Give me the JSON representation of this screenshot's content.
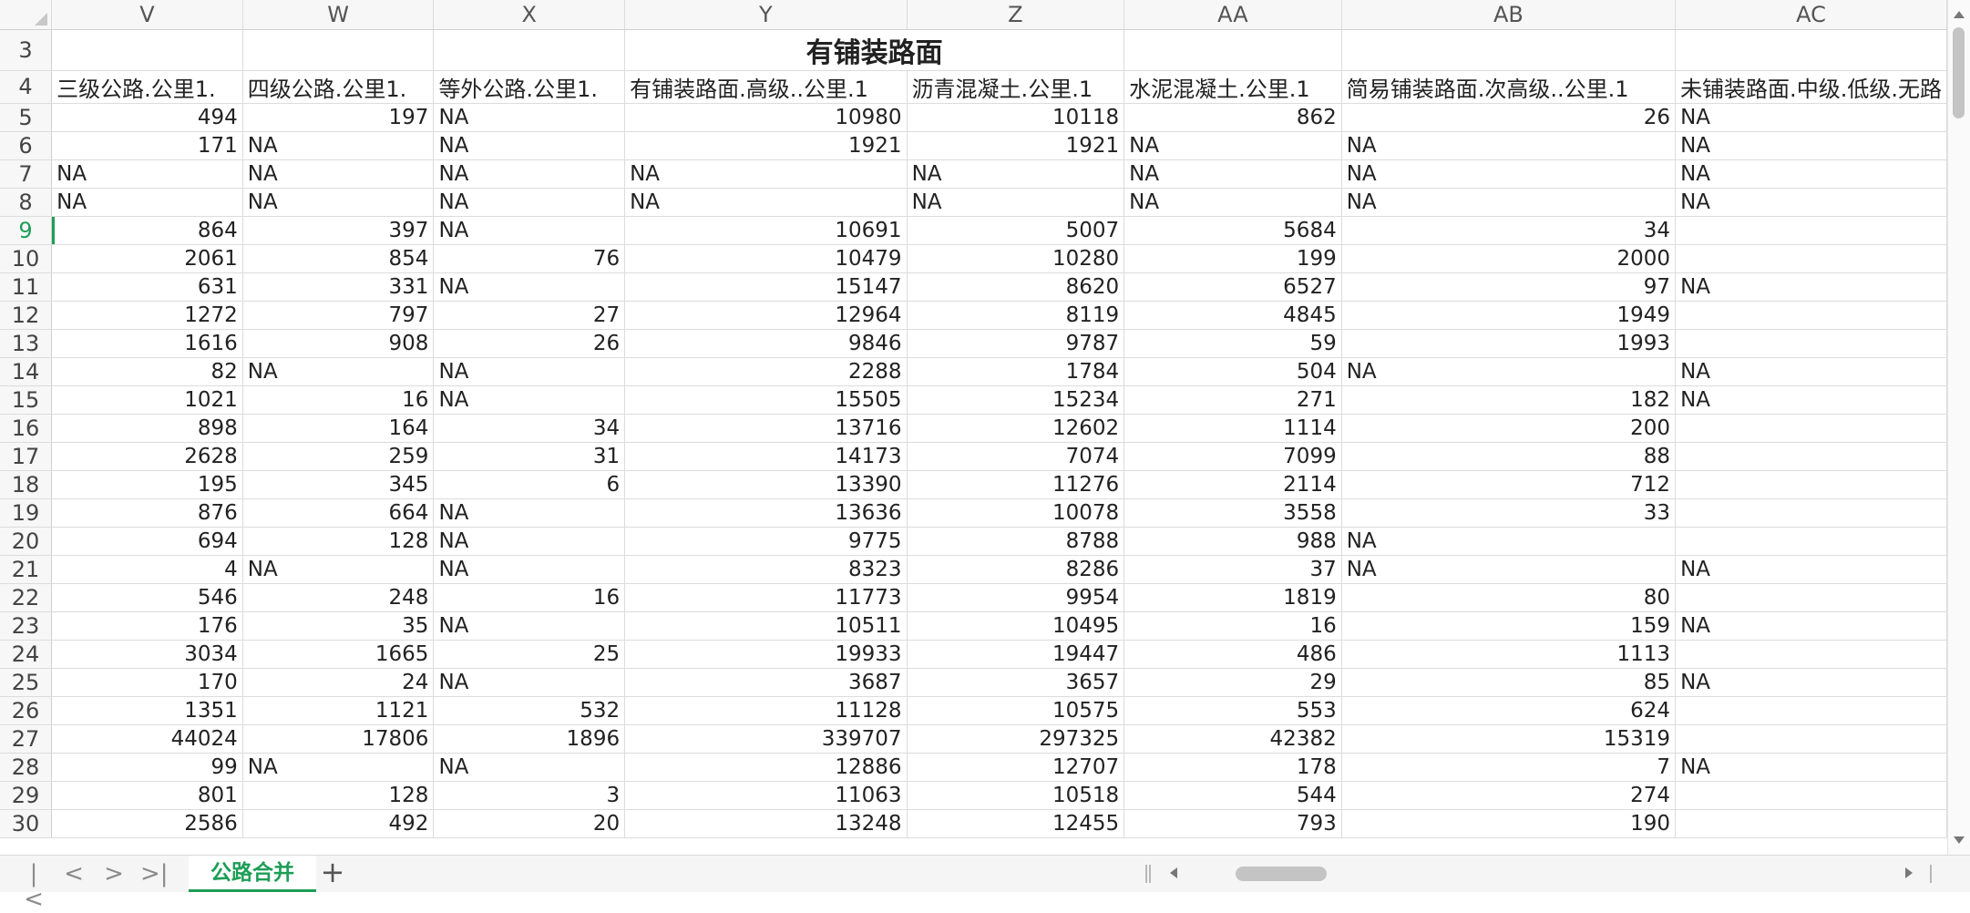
{
  "sheet": {
    "columns": [
      "V",
      "W",
      "X",
      "Y",
      "Z",
      "AA",
      "AB",
      "AC"
    ],
    "title_row": {
      "row": "3",
      "title": "有铺装路面"
    },
    "header_row": {
      "row": "4",
      "cells": [
        "三级公路.公里1.",
        "四级公路.公里1.",
        "等外公路.公里1.",
        "有铺装路面.高级..公里.1",
        "沥青混凝土.公里.1",
        "水泥混凝土.公里.1",
        "简易铺装路面.次高级..公里.1",
        "未铺装路面.中级.低级.无路"
      ]
    },
    "active_row": "9",
    "rows": [
      {
        "n": "5",
        "c": [
          "494",
          "197",
          "NA",
          "10980",
          "10118",
          "862",
          "26",
          "NA"
        ]
      },
      {
        "n": "6",
        "c": [
          "171",
          "NA",
          "NA",
          "1921",
          "1921",
          "NA",
          "NA",
          "NA"
        ]
      },
      {
        "n": "7",
        "c": [
          "NA",
          "NA",
          "NA",
          "NA",
          "NA",
          "NA",
          "NA",
          "NA"
        ]
      },
      {
        "n": "8",
        "c": [
          "NA",
          "NA",
          "NA",
          "NA",
          "NA",
          "NA",
          "NA",
          "NA"
        ]
      },
      {
        "n": "9",
        "c": [
          "864",
          "397",
          "NA",
          "10691",
          "5007",
          "5684",
          "34",
          ""
        ]
      },
      {
        "n": "10",
        "c": [
          "2061",
          "854",
          "76",
          "10479",
          "10280",
          "199",
          "2000",
          ""
        ]
      },
      {
        "n": "11",
        "c": [
          "631",
          "331",
          "NA",
          "15147",
          "8620",
          "6527",
          "97",
          "NA"
        ]
      },
      {
        "n": "12",
        "c": [
          "1272",
          "797",
          "27",
          "12964",
          "8119",
          "4845",
          "1949",
          ""
        ]
      },
      {
        "n": "13",
        "c": [
          "1616",
          "908",
          "26",
          "9846",
          "9787",
          "59",
          "1993",
          ""
        ]
      },
      {
        "n": "14",
        "c": [
          "82",
          "NA",
          "NA",
          "2288",
          "1784",
          "504",
          "NA",
          "NA"
        ]
      },
      {
        "n": "15",
        "c": [
          "1021",
          "16",
          "NA",
          "15505",
          "15234",
          "271",
          "182",
          "NA"
        ]
      },
      {
        "n": "16",
        "c": [
          "898",
          "164",
          "34",
          "13716",
          "12602",
          "1114",
          "200",
          ""
        ]
      },
      {
        "n": "17",
        "c": [
          "2628",
          "259",
          "31",
          "14173",
          "7074",
          "7099",
          "88",
          ""
        ]
      },
      {
        "n": "18",
        "c": [
          "195",
          "345",
          "6",
          "13390",
          "11276",
          "2114",
          "712",
          ""
        ]
      },
      {
        "n": "19",
        "c": [
          "876",
          "664",
          "NA",
          "13636",
          "10078",
          "3558",
          "33",
          ""
        ]
      },
      {
        "n": "20",
        "c": [
          "694",
          "128",
          "NA",
          "9775",
          "8788",
          "988",
          "NA",
          ""
        ]
      },
      {
        "n": "21",
        "c": [
          "4",
          "NA",
          "NA",
          "8323",
          "8286",
          "37",
          "NA",
          "NA"
        ]
      },
      {
        "n": "22",
        "c": [
          "546",
          "248",
          "16",
          "11773",
          "9954",
          "1819",
          "80",
          ""
        ]
      },
      {
        "n": "23",
        "c": [
          "176",
          "35",
          "NA",
          "10511",
          "10495",
          "16",
          "159",
          "NA"
        ]
      },
      {
        "n": "24",
        "c": [
          "3034",
          "1665",
          "25",
          "19933",
          "19447",
          "486",
          "1113",
          ""
        ]
      },
      {
        "n": "25",
        "c": [
          "170",
          "24",
          "NA",
          "3687",
          "3657",
          "29",
          "85",
          "NA"
        ]
      },
      {
        "n": "26",
        "c": [
          "1351",
          "1121",
          "532",
          "11128",
          "10575",
          "553",
          "624",
          ""
        ]
      },
      {
        "n": "27",
        "c": [
          "44024",
          "17806",
          "1896",
          "339707",
          "297325",
          "42382",
          "15319",
          ""
        ]
      },
      {
        "n": "28",
        "c": [
          "99",
          "NA",
          "NA",
          "12886",
          "12707",
          "178",
          "7",
          "NA"
        ]
      },
      {
        "n": "29",
        "c": [
          "801",
          "128",
          "3",
          "11063",
          "10518",
          "544",
          "274",
          ""
        ]
      },
      {
        "n": "30",
        "c": [
          "2586",
          "492",
          "20",
          "13248",
          "12455",
          "793",
          "190",
          ""
        ]
      }
    ]
  },
  "bottombar": {
    "nav": [
      "|<",
      "<",
      ">",
      ">|"
    ],
    "tab": "公路合并",
    "add": "+"
  },
  "colors": {
    "accent": "#1e9e56",
    "grid": "#dcdcdc",
    "header_bg": "#f7f7f7"
  }
}
